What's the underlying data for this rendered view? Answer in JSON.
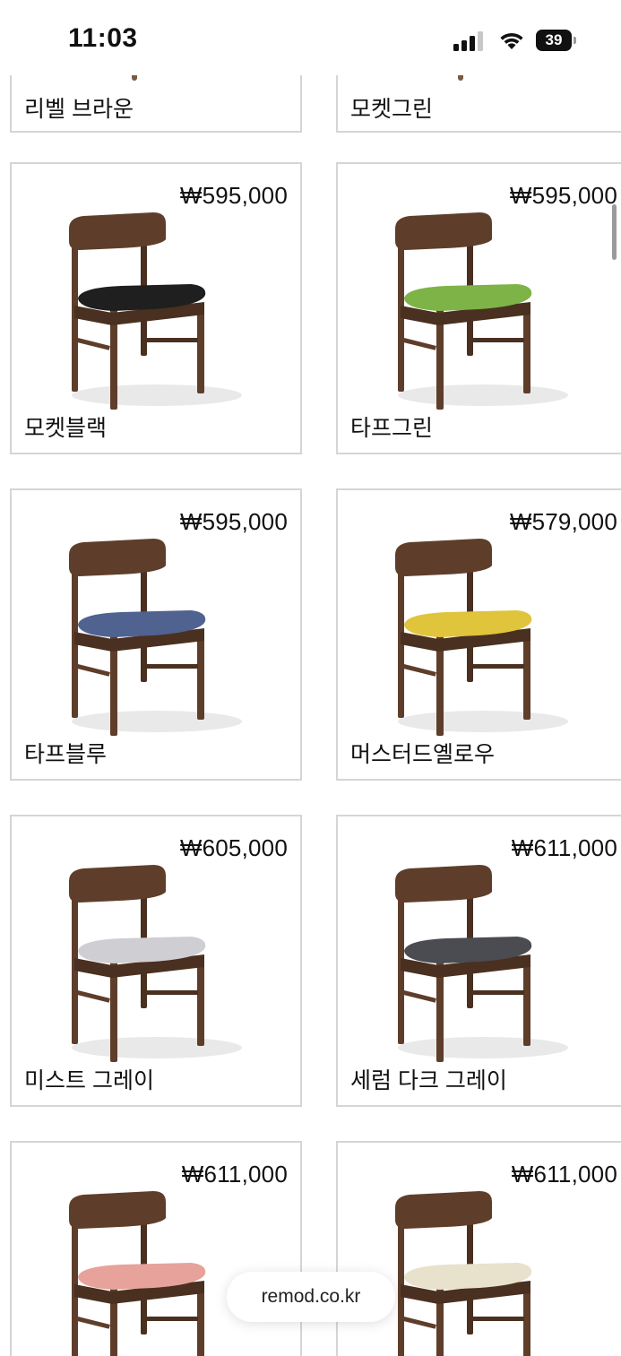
{
  "status": {
    "time": "11:03",
    "battery": "39"
  },
  "top_row": [
    {
      "name": "리벨 브라운"
    },
    {
      "name": "모켓그린"
    }
  ],
  "products": [
    {
      "price": "₩595,000",
      "name": "모켓블랙",
      "seat_color": "#1f1f1f"
    },
    {
      "price": "₩595,000",
      "name": "타프그린",
      "seat_color": "#7db347"
    },
    {
      "price": "₩595,000",
      "name": "타프블루",
      "seat_color": "#4f6290"
    },
    {
      "price": "₩579,000",
      "name": "머스터드옐로우",
      "seat_color": "#dfc43c"
    },
    {
      "price": "₩605,000",
      "name": "미스트 그레이",
      "seat_color": "#cfcfd3"
    },
    {
      "price": "₩611,000",
      "name": "세럼 다크 그레이",
      "seat_color": "#4a4c51"
    },
    {
      "price": "₩611,000",
      "name": "",
      "seat_color": "#e7a29b"
    },
    {
      "price": "₩611,000",
      "name": "",
      "seat_color": "#e8e1cc"
    }
  ],
  "wood_color": "#5e3e2a",
  "browser": {
    "url": "remod.co.kr"
  }
}
